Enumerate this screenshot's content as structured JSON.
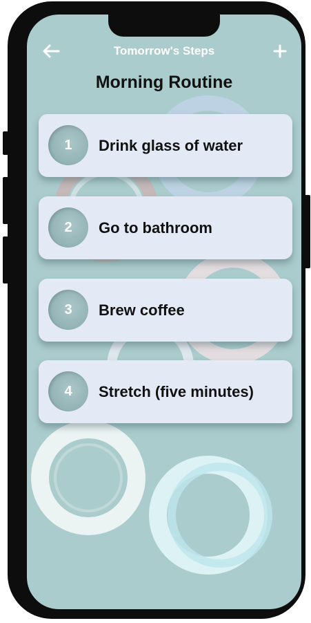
{
  "header": {
    "title": "Tomorrow's Steps",
    "back_icon": "arrow-left-icon",
    "add_icon": "plus-icon"
  },
  "page": {
    "title": "Morning Routine"
  },
  "steps": [
    {
      "number": "1",
      "label": "Drink glass of water"
    },
    {
      "number": "2",
      "label": "Go to bathroom"
    },
    {
      "number": "3",
      "label": "Brew coffee"
    },
    {
      "number": "4",
      "label": "Stretch (five minutes)"
    }
  ],
  "colors": {
    "screen_background": "#abcccd",
    "card_background": "#e4eaf5",
    "phone_frame": "#0d0d0d",
    "text_primary": "#111111",
    "text_on_accent": "#ffffff"
  }
}
